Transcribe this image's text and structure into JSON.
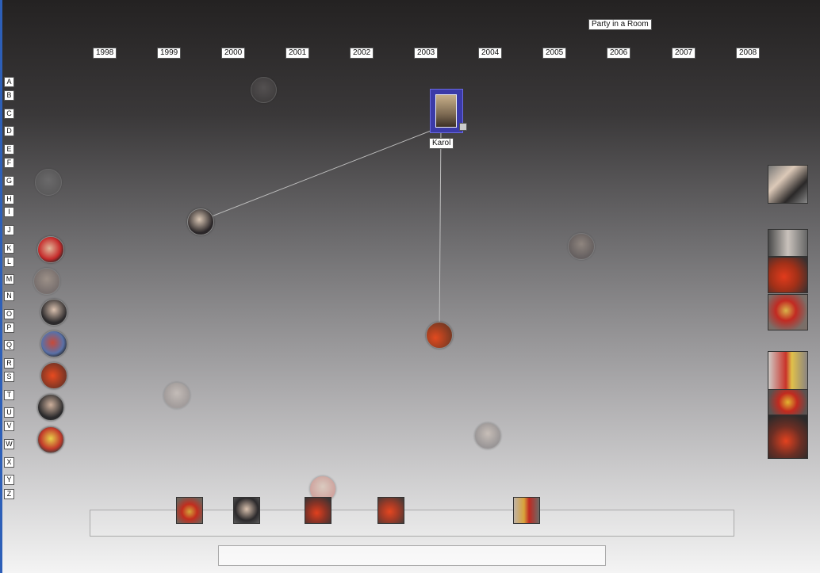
{
  "header": {
    "title": "Party in a Room"
  },
  "years": [
    "1998",
    "1999",
    "2000",
    "2001",
    "2002",
    "2003",
    "2004",
    "2005",
    "2006",
    "2007",
    "2008"
  ],
  "letters": [
    "A",
    "B",
    "C",
    "D",
    "E",
    "F",
    "G",
    "H",
    "I",
    "J",
    "K",
    "L",
    "M",
    "N",
    "O",
    "P",
    "Q",
    "R",
    "S",
    "T",
    "U",
    "V",
    "W",
    "X",
    "Y",
    "Z"
  ],
  "selected": {
    "name": "Karol"
  },
  "colors": {
    "accent_frame": "#3b3aa8",
    "left_bar": "#2d5fb8"
  }
}
